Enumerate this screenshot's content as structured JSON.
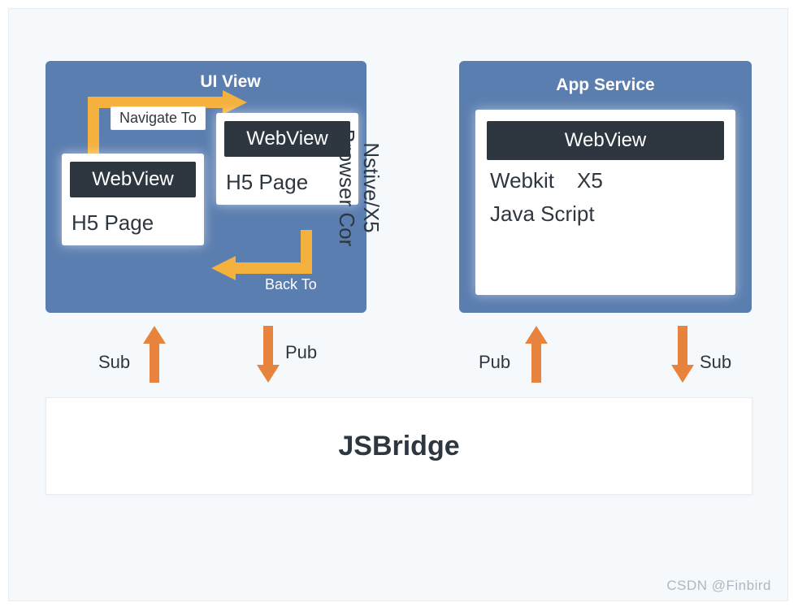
{
  "colors": {
    "page_bg": "#f6f9fc",
    "panel_blue": "#5b7eb0",
    "arrow_gold": "#f4b13d",
    "arrow_orange": "#e8833d",
    "text_dark": "#2e3740",
    "webview_bar": "#2e3740"
  },
  "uiview": {
    "title": "UI View",
    "navigate_label": "Navigate To",
    "back_label": "Back To",
    "page_a": {
      "webview": "WebView",
      "body": "H5 Page"
    },
    "page_b": {
      "webview": "WebView",
      "body": "H5 Page"
    }
  },
  "appservice": {
    "title": "App Service",
    "webview": "WebView",
    "tech1a": "Webkit",
    "tech1b": "X5",
    "tech2": "Java Script"
  },
  "middle": {
    "line1": "Nstive/X5",
    "line2": "Browser Cor"
  },
  "flows": {
    "left_sub": "Sub",
    "left_pub": "Pub",
    "right_pub": "Pub",
    "right_sub": "Sub"
  },
  "bridge": {
    "label": "JSBridge"
  },
  "watermark": "CSDN @Finbird"
}
